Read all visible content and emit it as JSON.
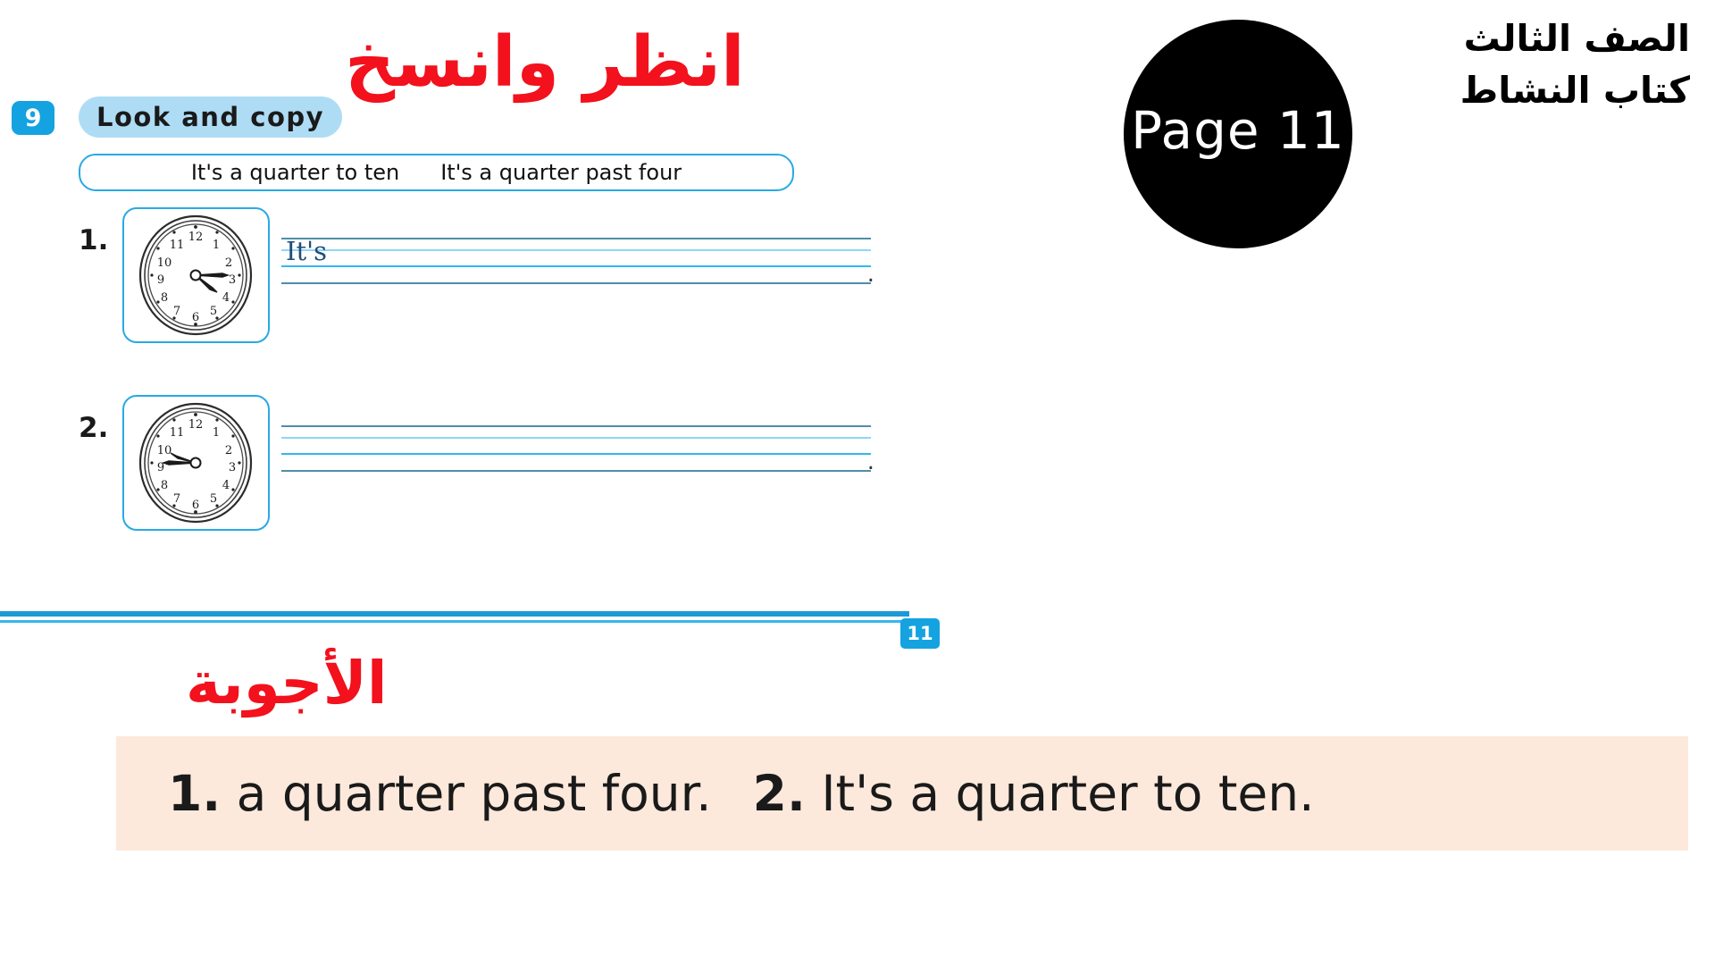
{
  "header": {
    "grade_line": "الصف الثالث",
    "book_line": "كتاب النشاط",
    "page_circle_label": "Page 11"
  },
  "exercise": {
    "number": "9",
    "title": "Look and copy",
    "arabic_instruction": "انظر وانسخ",
    "word_bank": [
      "It's a quarter to ten",
      "It's a quarter past four"
    ],
    "items": [
      {
        "number": "1.",
        "clock_name": "clock-quarter-past-four",
        "hour_hand_deg": 127.5,
        "minute_hand_deg": 90,
        "write_prompt": "It's",
        "write_period": "."
      },
      {
        "number": "2.",
        "clock_name": "clock-quarter-to-ten",
        "hour_hand_deg": 262.5,
        "minute_hand_deg": 270,
        "write_prompt": "",
        "write_period": "."
      }
    ],
    "clock_numerals": [
      "1",
      "2",
      "3",
      "4",
      "5",
      "6",
      "7",
      "8",
      "9",
      "10",
      "11",
      "12"
    ]
  },
  "footer": {
    "page_badge": "11",
    "answers_heading": "الأجوبة",
    "answers": [
      {
        "num": "1.",
        "text": "a quarter past four."
      },
      {
        "num": "2.",
        "text": "It's a quarter to ten."
      }
    ]
  },
  "colors": {
    "accent_blue": "#14a3e0",
    "light_blue": "#aedcf5",
    "line_blue": "#35b6ef",
    "red": "#f2111c",
    "answer_bg": "#fce9dc",
    "black": "#000000"
  }
}
